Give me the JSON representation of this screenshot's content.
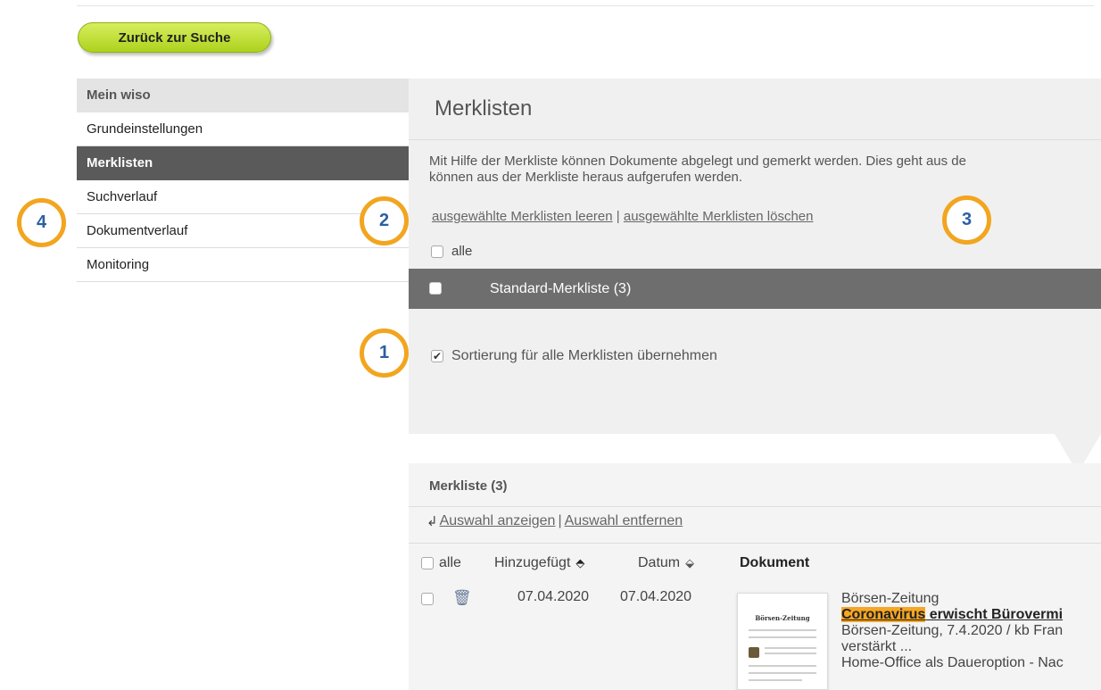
{
  "back_button": {
    "label": "Zurück zur Suche"
  },
  "sidebar": {
    "header": "Mein wiso",
    "items": [
      {
        "label": "Grundeinstellungen",
        "active": false
      },
      {
        "label": "Merklisten",
        "active": true
      },
      {
        "label": "Suchverlauf",
        "active": false
      },
      {
        "label": "Dokumentverlauf",
        "active": false
      },
      {
        "label": "Monitoring",
        "active": false
      }
    ]
  },
  "main": {
    "title": "Merklisten",
    "description_line1": "Mit Hilfe der Merkliste können Dokumente abgelegt und gemerkt werden. Dies geht aus de",
    "description_line2": "können aus der Merkliste heraus aufgerufen werden.",
    "link_empty": "ausgewählte Merklisten leeren",
    "link_separator": "|",
    "link_delete": "ausgewählte Merklisten löschen",
    "select_all_label": "alle",
    "standard_list_label": "Standard-Merkliste (3)",
    "sort_all_label": "Sortierung für alle Merklisten übernehmen",
    "sort_all_checked": true
  },
  "list": {
    "title": "Merkliste (3)",
    "action_show": "Auswahl anzeigen",
    "action_separator": "|",
    "action_remove": "Auswahl entfernen",
    "columns": {
      "select_all": "alle",
      "added": "Hinzugefügt",
      "date": "Datum",
      "document": "Dokument"
    },
    "rows": [
      {
        "added": "07.04.2020",
        "date": "07.04.2020",
        "thumb_title": "Börsen-Zeitung",
        "source": "Börsen-Zeitung",
        "headline_highlight": "Coronavirus",
        "headline_rest": " erwischt Bürovermi",
        "meta": "Börsen-Zeitung, 7.4.2020 / kb Fran",
        "snippet1": "verstärkt ...",
        "snippet2": "Home-Office als Daueroption - Nac"
      }
    ]
  },
  "callouts": {
    "b1": "1",
    "b2": "2",
    "b3": "3",
    "b4": "4"
  },
  "colors": {
    "accent_green": "#aed21d",
    "callout_orange": "#f2a51f",
    "callout_text": "#2b5fa2",
    "active_bg": "#5a5a5a"
  }
}
